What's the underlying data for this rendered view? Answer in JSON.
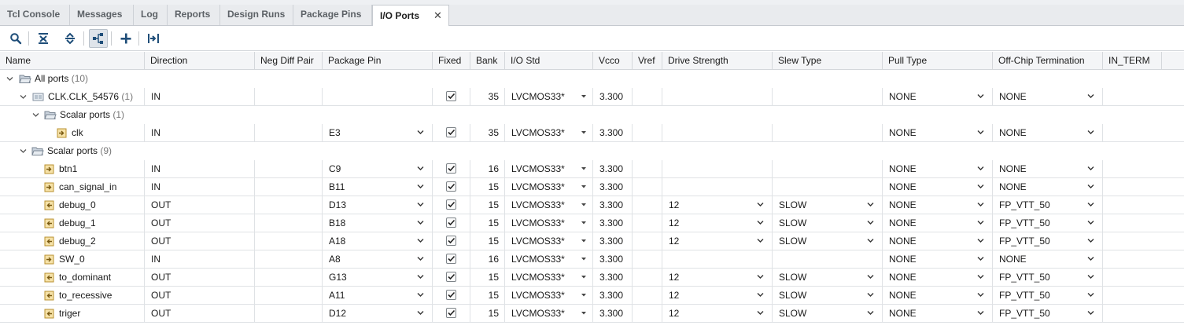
{
  "tabs": [
    {
      "label": "Tcl Console"
    },
    {
      "label": "Messages"
    },
    {
      "label": "Log"
    },
    {
      "label": "Reports"
    },
    {
      "label": "Design Runs"
    },
    {
      "label": "Package Pins"
    },
    {
      "label": "I/O Ports",
      "active": true
    }
  ],
  "toolbar": {
    "buttons": [
      "search-icon",
      "collapse-all-icon",
      "expand-all-icon",
      "group-by-interface-icon",
      "add-icon",
      "export-icon"
    ]
  },
  "columns": [
    "Name",
    "Direction",
    "Neg Diff Pair",
    "Package Pin",
    "Fixed",
    "Bank",
    "I/O Std",
    "Vcco",
    "Vref",
    "Drive Strength",
    "Slew Type",
    "Pull Type",
    "Off-Chip Termination",
    "IN_TERM"
  ],
  "groups": {
    "all_ports": {
      "label": "All ports",
      "count": "(10)"
    },
    "clk_interface": {
      "label": "CLK.CLK_54576",
      "count": "(1)",
      "direction": "IN",
      "fixed": true,
      "bank": "35",
      "iostd": "LVCMOS33*",
      "vcco": "3.300",
      "pull": "NONE",
      "offchip": "NONE"
    },
    "clk_scalar": {
      "label": "Scalar ports",
      "count": "(1)"
    },
    "scalar": {
      "label": "Scalar ports",
      "count": "(9)"
    }
  },
  "ports": [
    {
      "name": "clk",
      "direction": "IN",
      "pin": "E3",
      "fixed": true,
      "bank": "35",
      "iostd": "LVCMOS33*",
      "vcco": "3.300",
      "drive": "",
      "slew": "",
      "pull": "NONE",
      "offchip": "NONE"
    },
    {
      "name": "btn1",
      "direction": "IN",
      "pin": "C9",
      "fixed": true,
      "bank": "16",
      "iostd": "LVCMOS33*",
      "vcco": "3.300",
      "drive": "",
      "slew": "",
      "pull": "NONE",
      "offchip": "NONE"
    },
    {
      "name": "can_signal_in",
      "direction": "IN",
      "pin": "B11",
      "fixed": true,
      "bank": "15",
      "iostd": "LVCMOS33*",
      "vcco": "3.300",
      "drive": "",
      "slew": "",
      "pull": "NONE",
      "offchip": "NONE"
    },
    {
      "name": "debug_0",
      "direction": "OUT",
      "pin": "D13",
      "fixed": true,
      "bank": "15",
      "iostd": "LVCMOS33*",
      "vcco": "3.300",
      "drive": "12",
      "slew": "SLOW",
      "pull": "NONE",
      "offchip": "FP_VTT_50"
    },
    {
      "name": "debug_1",
      "direction": "OUT",
      "pin": "B18",
      "fixed": true,
      "bank": "15",
      "iostd": "LVCMOS33*",
      "vcco": "3.300",
      "drive": "12",
      "slew": "SLOW",
      "pull": "NONE",
      "offchip": "FP_VTT_50"
    },
    {
      "name": "debug_2",
      "direction": "OUT",
      "pin": "A18",
      "fixed": true,
      "bank": "15",
      "iostd": "LVCMOS33*",
      "vcco": "3.300",
      "drive": "12",
      "slew": "SLOW",
      "pull": "NONE",
      "offchip": "FP_VTT_50"
    },
    {
      "name": "SW_0",
      "direction": "IN",
      "pin": "A8",
      "fixed": true,
      "bank": "16",
      "iostd": "LVCMOS33*",
      "vcco": "3.300",
      "drive": "",
      "slew": "",
      "pull": "NONE",
      "offchip": "NONE"
    },
    {
      "name": "to_dominant",
      "direction": "OUT",
      "pin": "G13",
      "fixed": true,
      "bank": "15",
      "iostd": "LVCMOS33*",
      "vcco": "3.300",
      "drive": "12",
      "slew": "SLOW",
      "pull": "NONE",
      "offchip": "FP_VTT_50"
    },
    {
      "name": "to_recessive",
      "direction": "OUT",
      "pin": "A11",
      "fixed": true,
      "bank": "15",
      "iostd": "LVCMOS33*",
      "vcco": "3.300",
      "drive": "12",
      "slew": "SLOW",
      "pull": "NONE",
      "offchip": "FP_VTT_50"
    },
    {
      "name": "triger",
      "direction": "OUT",
      "pin": "D12",
      "fixed": true,
      "bank": "15",
      "iostd": "LVCMOS33*",
      "vcco": "3.300",
      "drive": "12",
      "slew": "SLOW",
      "pull": "NONE",
      "offchip": "FP_VTT_50"
    }
  ]
}
